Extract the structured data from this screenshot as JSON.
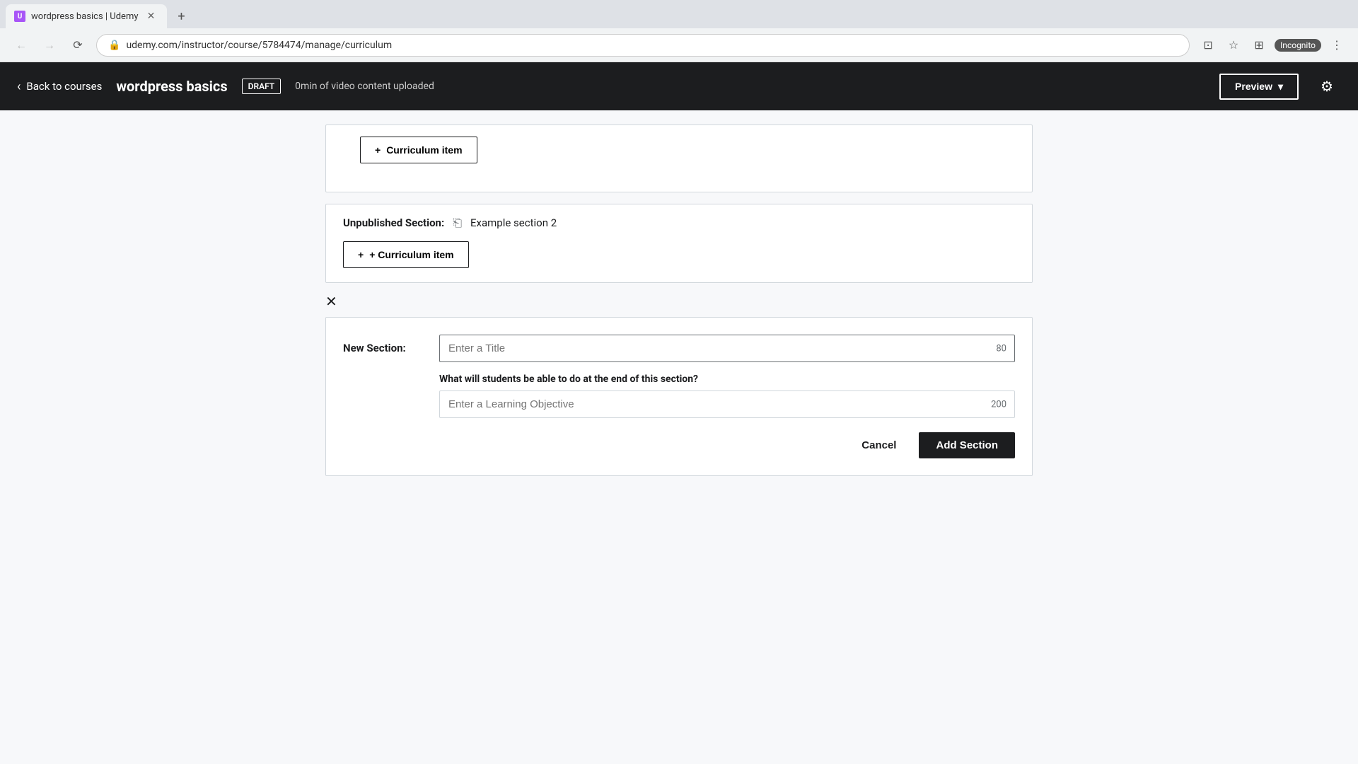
{
  "browser": {
    "tab_title": "wordpress basics | Udemy",
    "url": "udemy.com/instructor/course/5784474/manage/curriculum",
    "incognito_label": "Incognito"
  },
  "header": {
    "back_label": "Back to courses",
    "course_title": "wordpress basics",
    "draft_label": "DRAFT",
    "video_info": "0min of video content uploaded",
    "preview_label": "Preview",
    "preview_arrow": "▾"
  },
  "sections": [
    {
      "id": "section1",
      "type": "partial"
    },
    {
      "id": "section2",
      "label": "Unpublished Section:",
      "name": "Example section 2",
      "curriculum_btn": "+ Curriculum item"
    }
  ],
  "new_section_form": {
    "close_icon": "✕",
    "label": "New Section:",
    "title_placeholder": "Enter a Title",
    "title_char_count": "80",
    "objective_question": "What will students be able to do at the end of this section?",
    "objective_placeholder": "Enter a Learning Objective",
    "objective_char_count": "200",
    "cancel_label": "Cancel",
    "add_label": "Add Section"
  }
}
